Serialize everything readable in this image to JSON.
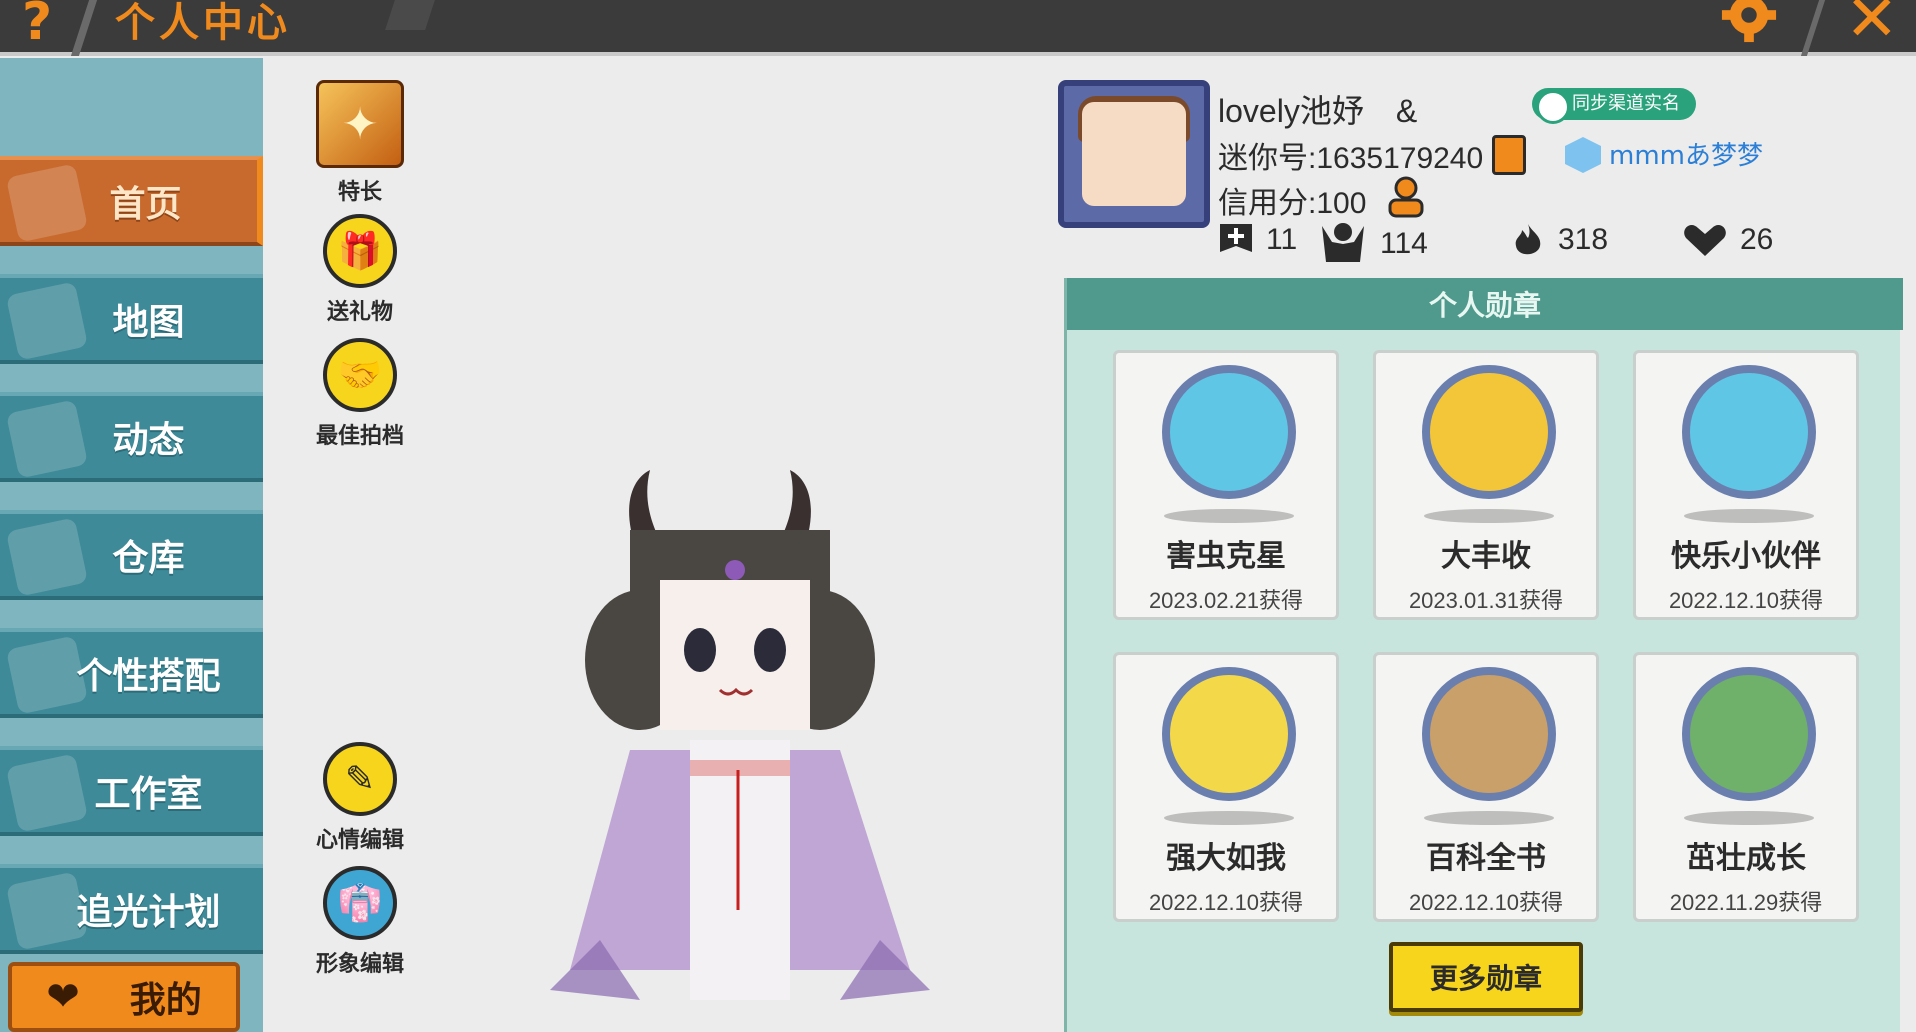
{
  "topbar": {
    "help_glyph": "?",
    "title": "个人中心",
    "close_glyph": "✕"
  },
  "nav": {
    "items": [
      {
        "label": "首页",
        "active": true
      },
      {
        "label": "地图"
      },
      {
        "label": "动态"
      },
      {
        "label": "仓库"
      },
      {
        "label": "个性搭配"
      },
      {
        "label": "工作室"
      },
      {
        "label": "追光计划"
      }
    ],
    "my_label": "我的"
  },
  "actions": {
    "specialty": "特长",
    "send_gift": "送礼物",
    "best_photo": "最佳拍档",
    "mood_edit": "心情编辑",
    "image_edit": "形象编辑"
  },
  "profile": {
    "name": "lovely池妤　&",
    "mini_id": "迷你号:1635179240",
    "credit": "信用分:100",
    "sync_label": "同步渠道实名",
    "clan": "mmmあ梦梦",
    "stats": {
      "adds": "11",
      "fans": "114",
      "heat": "318",
      "likes": "26"
    }
  },
  "badges": {
    "title": "个人勋章",
    "items": [
      {
        "name": "害虫克星",
        "date": "2023.02.21获得",
        "color": "#5fc6e6"
      },
      {
        "name": "大丰收",
        "date": "2023.01.31获得",
        "color": "#f3c63a"
      },
      {
        "name": "快乐小伙伴",
        "date": "2022.12.10获得",
        "color": "#5fc6e6"
      },
      {
        "name": "强大如我",
        "date": "2022.12.10获得",
        "color": "#f3d94a"
      },
      {
        "name": "百科全书",
        "date": "2022.12.10获得",
        "color": "#c9c9c9"
      },
      {
        "name": "茁壮成长",
        "date": "2022.11.29获得",
        "color": "#6fa6d6"
      }
    ],
    "more_label": "更多勋章"
  },
  "colors": {
    "accent": "#f08a1c",
    "nav": "#3e8a98",
    "panel_head": "#4f9a8c"
  }
}
